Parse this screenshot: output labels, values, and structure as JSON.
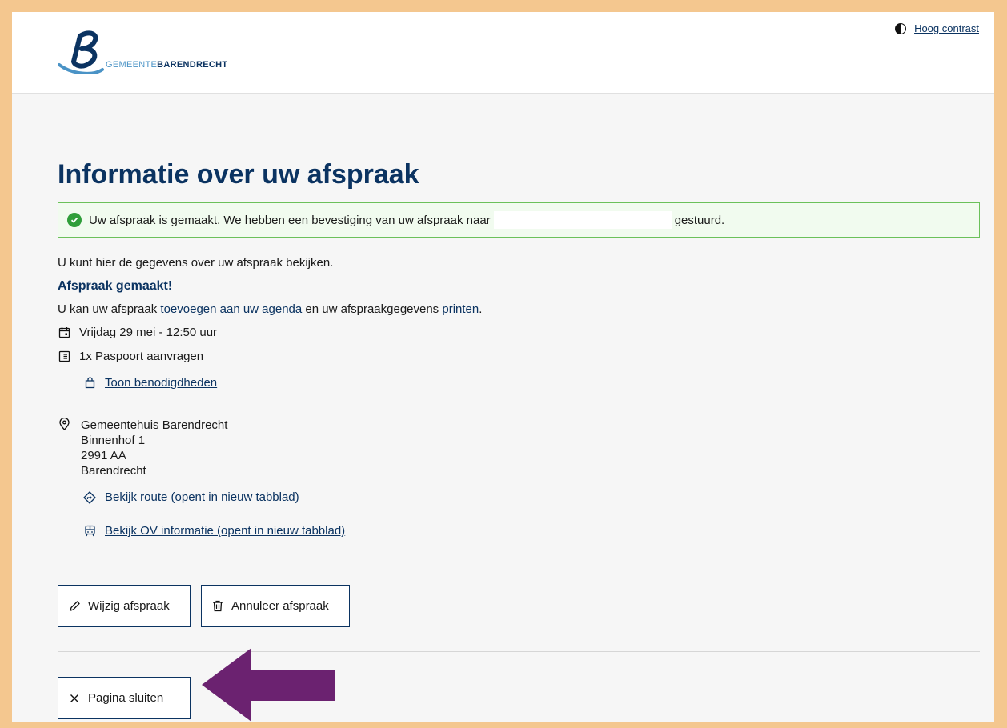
{
  "header": {
    "logo_prefix": "GEMEENTE",
    "logo_name": "BARENDRECHT",
    "contrast_label": "Hoog contrast"
  },
  "page": {
    "title": "Informatie over uw afspraak"
  },
  "alert": {
    "text_before": "Uw afspraak is gemaakt. We hebben een bevestiging van uw afspraak naar",
    "text_after": "gestuurd."
  },
  "intro": "U kunt hier de gegevens over uw afspraak bekijken.",
  "appointment": {
    "heading": "Afspraak gemaakt!",
    "lead_1": "U kan uw afspraak ",
    "calendar_link": "toevoegen aan uw agenda",
    "lead_2": " en uw afspraakgegevens ",
    "print_link": "printen",
    "lead_3": ".",
    "datetime": "Vrijdag 29 mei - 12:50 uur",
    "product": "1x Paspoort aanvragen",
    "requirements_link": "Toon benodigdheden",
    "location": {
      "name": "Gemeentehuis Barendrecht",
      "street": "Binnenhof 1",
      "postcode": "2991 AA",
      "city": "Barendrecht"
    },
    "route_link": "Bekijk route (opent in nieuw tabblad)",
    "ov_link": "Bekijk OV informatie (opent in nieuw tabblad)"
  },
  "actions": {
    "change_label": "Wijzig afspraak",
    "cancel_label": "Annuleer afspraak",
    "close_label": "Pagina sluiten"
  },
  "colors": {
    "brand": "#0b3361",
    "success": "#2f9e3a",
    "annotation_arrow": "#6b2270",
    "frame": "#f4c78f"
  }
}
